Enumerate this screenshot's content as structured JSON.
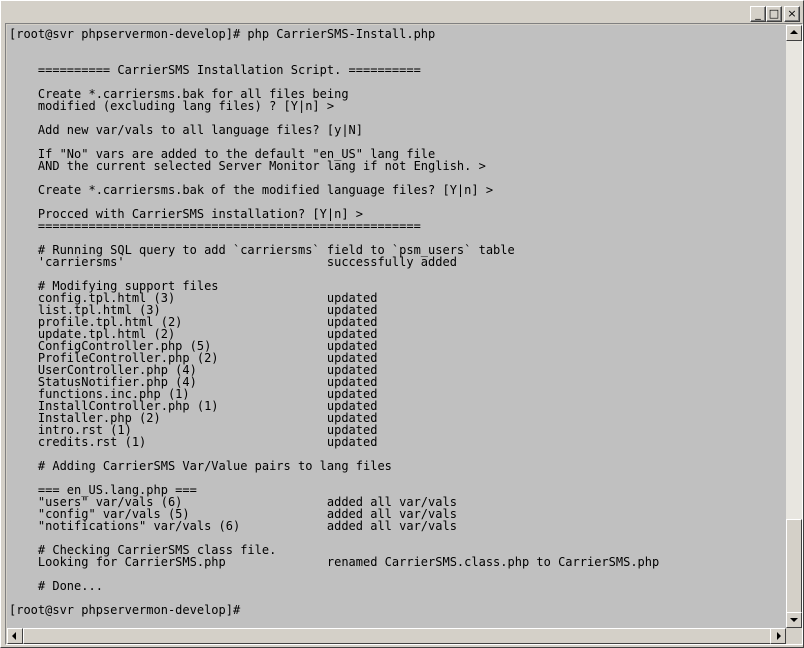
{
  "window": {
    "buttons": {
      "minimize": "_",
      "maximize": "□",
      "close": "×"
    }
  },
  "terminal": {
    "lines": [
      "[root@svr phpservermon-develop]# php CarrierSMS-Install.php",
      "",
      "",
      "    ========== CarrierSMS Installation Script. ==========",
      "",
      "    Create *.carriersms.bak for all files being",
      "    modified (excluding lang files) ? [Y|n] >",
      "",
      "    Add new var/vals to all language files? [y|N]",
      "",
      "    If \"No\" vars are added to the default \"en_US\" lang file",
      "    AND the current selected Server Monitor lang if not English. >",
      "",
      "    Create *.carriersms.bak of the modified language files? [Y|n] >",
      "",
      "    Procced with CarrierSMS installation? [Y|n] >",
      "    =====================================================",
      "",
      "    # Running SQL query to add `carriersms` field to `psm_users` table",
      "    'carriersms'                            successfully added",
      "",
      "    # Modifying support files",
      "    config.tpl.html (3)                     updated",
      "    list.tpl.html (3)                       updated",
      "    profile.tpl.html (2)                    updated",
      "    update.tpl.html (2)                     updated",
      "    ConfigController.php (5)                updated",
      "    ProfileController.php (2)               updated",
      "    UserController.php (4)                  updated",
      "    StatusNotifier.php (4)                  updated",
      "    functions.inc.php (1)                   updated",
      "    InstallController.php (1)               updated",
      "    Installer.php (2)                       updated",
      "    intro.rst (1)                           updated",
      "    credits.rst (1)                         updated",
      "",
      "    # Adding CarrierSMS Var/Value pairs to lang files",
      "",
      "    === en_US.lang.php ===",
      "    \"users\" var/vals (6)                    added all var/vals",
      "    \"config\" var/vals (5)                   added all var/vals",
      "    \"notifications\" var/vals (6)            added all var/vals",
      "",
      "    # Checking CarrierSMS class file.",
      "    Looking for CarrierSMS.php              renamed CarrierSMS.class.php to CarrierSMS.php",
      "",
      "    # Done...",
      "",
      "[root@svr phpservermon-develop]#"
    ]
  }
}
